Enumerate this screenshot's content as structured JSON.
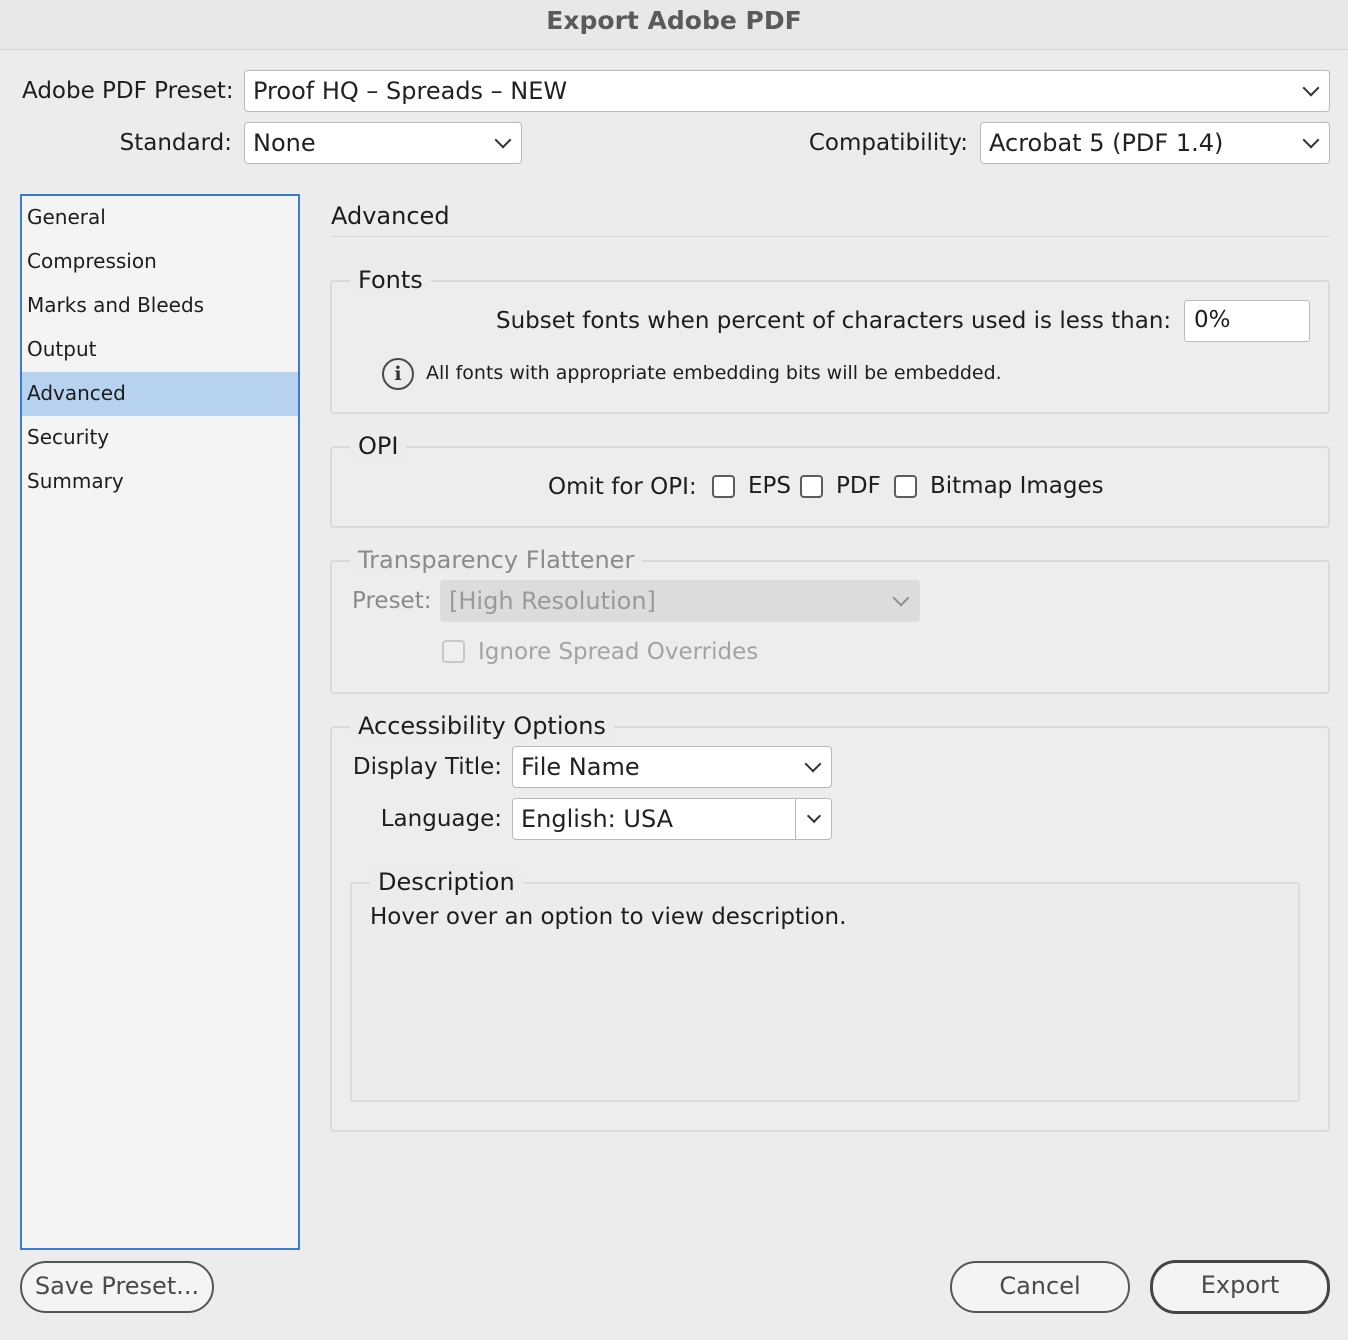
{
  "window": {
    "title": "Export Adobe PDF"
  },
  "header": {
    "preset_label": "Adobe PDF Preset:",
    "preset_value": "Proof HQ – Spreads – NEW",
    "standard_label": "Standard:",
    "standard_value": "None",
    "compatibility_label": "Compatibility:",
    "compatibility_value": "Acrobat 5 (PDF 1.4)"
  },
  "sidebar": {
    "items": [
      {
        "label": "General"
      },
      {
        "label": "Compression"
      },
      {
        "label": "Marks and Bleeds"
      },
      {
        "label": "Output"
      },
      {
        "label": "Advanced",
        "selected": true
      },
      {
        "label": "Security"
      },
      {
        "label": "Summary"
      }
    ]
  },
  "main": {
    "section_title": "Advanced",
    "fonts": {
      "legend": "Fonts",
      "subset_label": "Subset fonts when percent of characters used is less than:",
      "subset_value": "0%",
      "info_text": "All fonts with appropriate embedding bits will be embedded."
    },
    "opi": {
      "legend": "OPI",
      "omit_label": "Omit for OPI:",
      "options": [
        {
          "label": "EPS",
          "checked": false
        },
        {
          "label": "PDF",
          "checked": false
        },
        {
          "label": "Bitmap Images",
          "checked": false
        }
      ]
    },
    "transparency": {
      "legend": "Transparency Flattener",
      "preset_label": "Preset:",
      "preset_value": "[High Resolution]",
      "ignore_label": "Ignore Spread Overrides",
      "ignore_checked": false,
      "disabled": true
    },
    "accessibility": {
      "legend": "Accessibility Options",
      "display_title_label": "Display Title:",
      "display_title_value": "File Name",
      "language_label": "Language:",
      "language_value": "English: USA"
    },
    "description": {
      "legend": "Description",
      "text": "Hover over an option to view description."
    }
  },
  "footer": {
    "save_preset_label": "Save Preset...",
    "cancel_label": "Cancel",
    "export_label": "Export"
  },
  "colors": {
    "selection": "#b7d2ee",
    "focus_ring": "#3a7bd5"
  },
  "icons": {
    "dropdown": "chevron-down-icon",
    "info": "info-icon"
  }
}
